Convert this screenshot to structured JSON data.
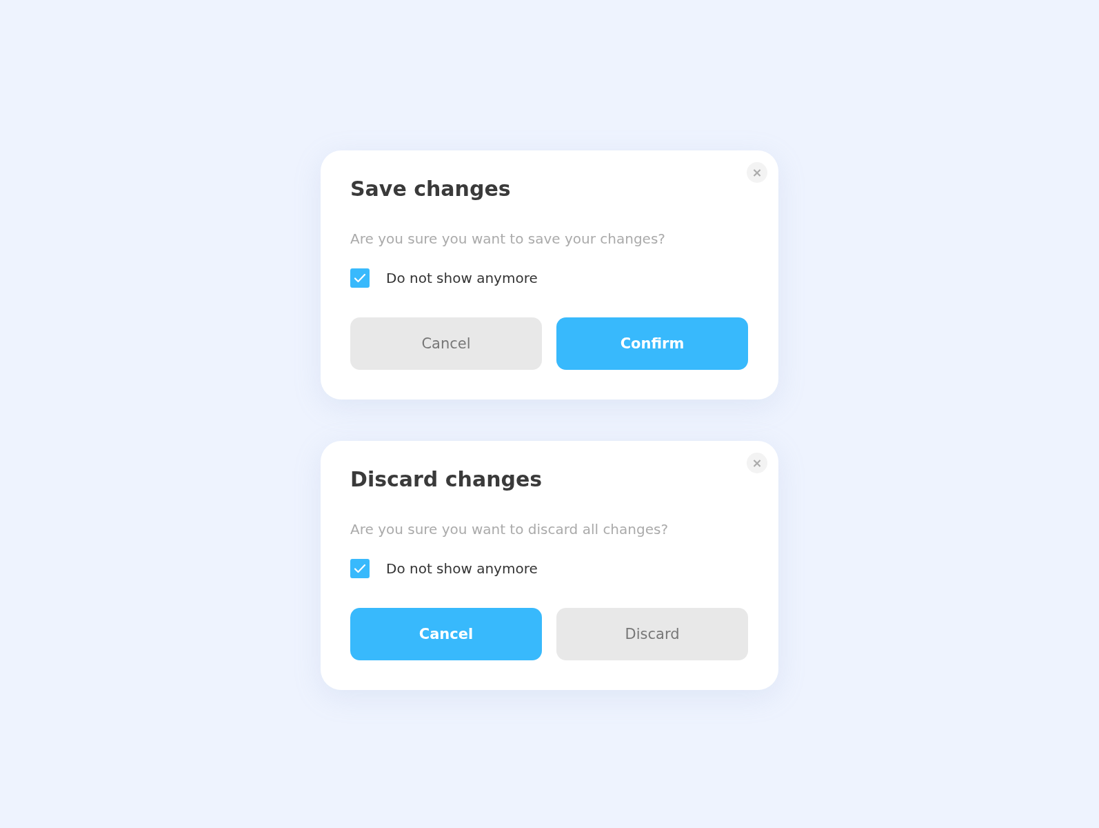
{
  "dialogs": [
    {
      "title": "Save changes",
      "close": "×",
      "message": "Are you sure you want to save your changes?",
      "checkbox": {
        "label": "Do not show anymore",
        "checked": true
      },
      "buttons": [
        {
          "label": "Cancel",
          "kind": "secondary"
        },
        {
          "label": "Confirm",
          "kind": "primary"
        }
      ]
    },
    {
      "title": "Discard changes",
      "close": "×",
      "message": "Are you sure you want to discard all changes?",
      "checkbox": {
        "label": "Do not show anymore",
        "checked": true
      },
      "buttons": [
        {
          "label": "Cancel",
          "kind": "primary"
        },
        {
          "label": "Discard",
          "kind": "secondary"
        }
      ]
    }
  ]
}
